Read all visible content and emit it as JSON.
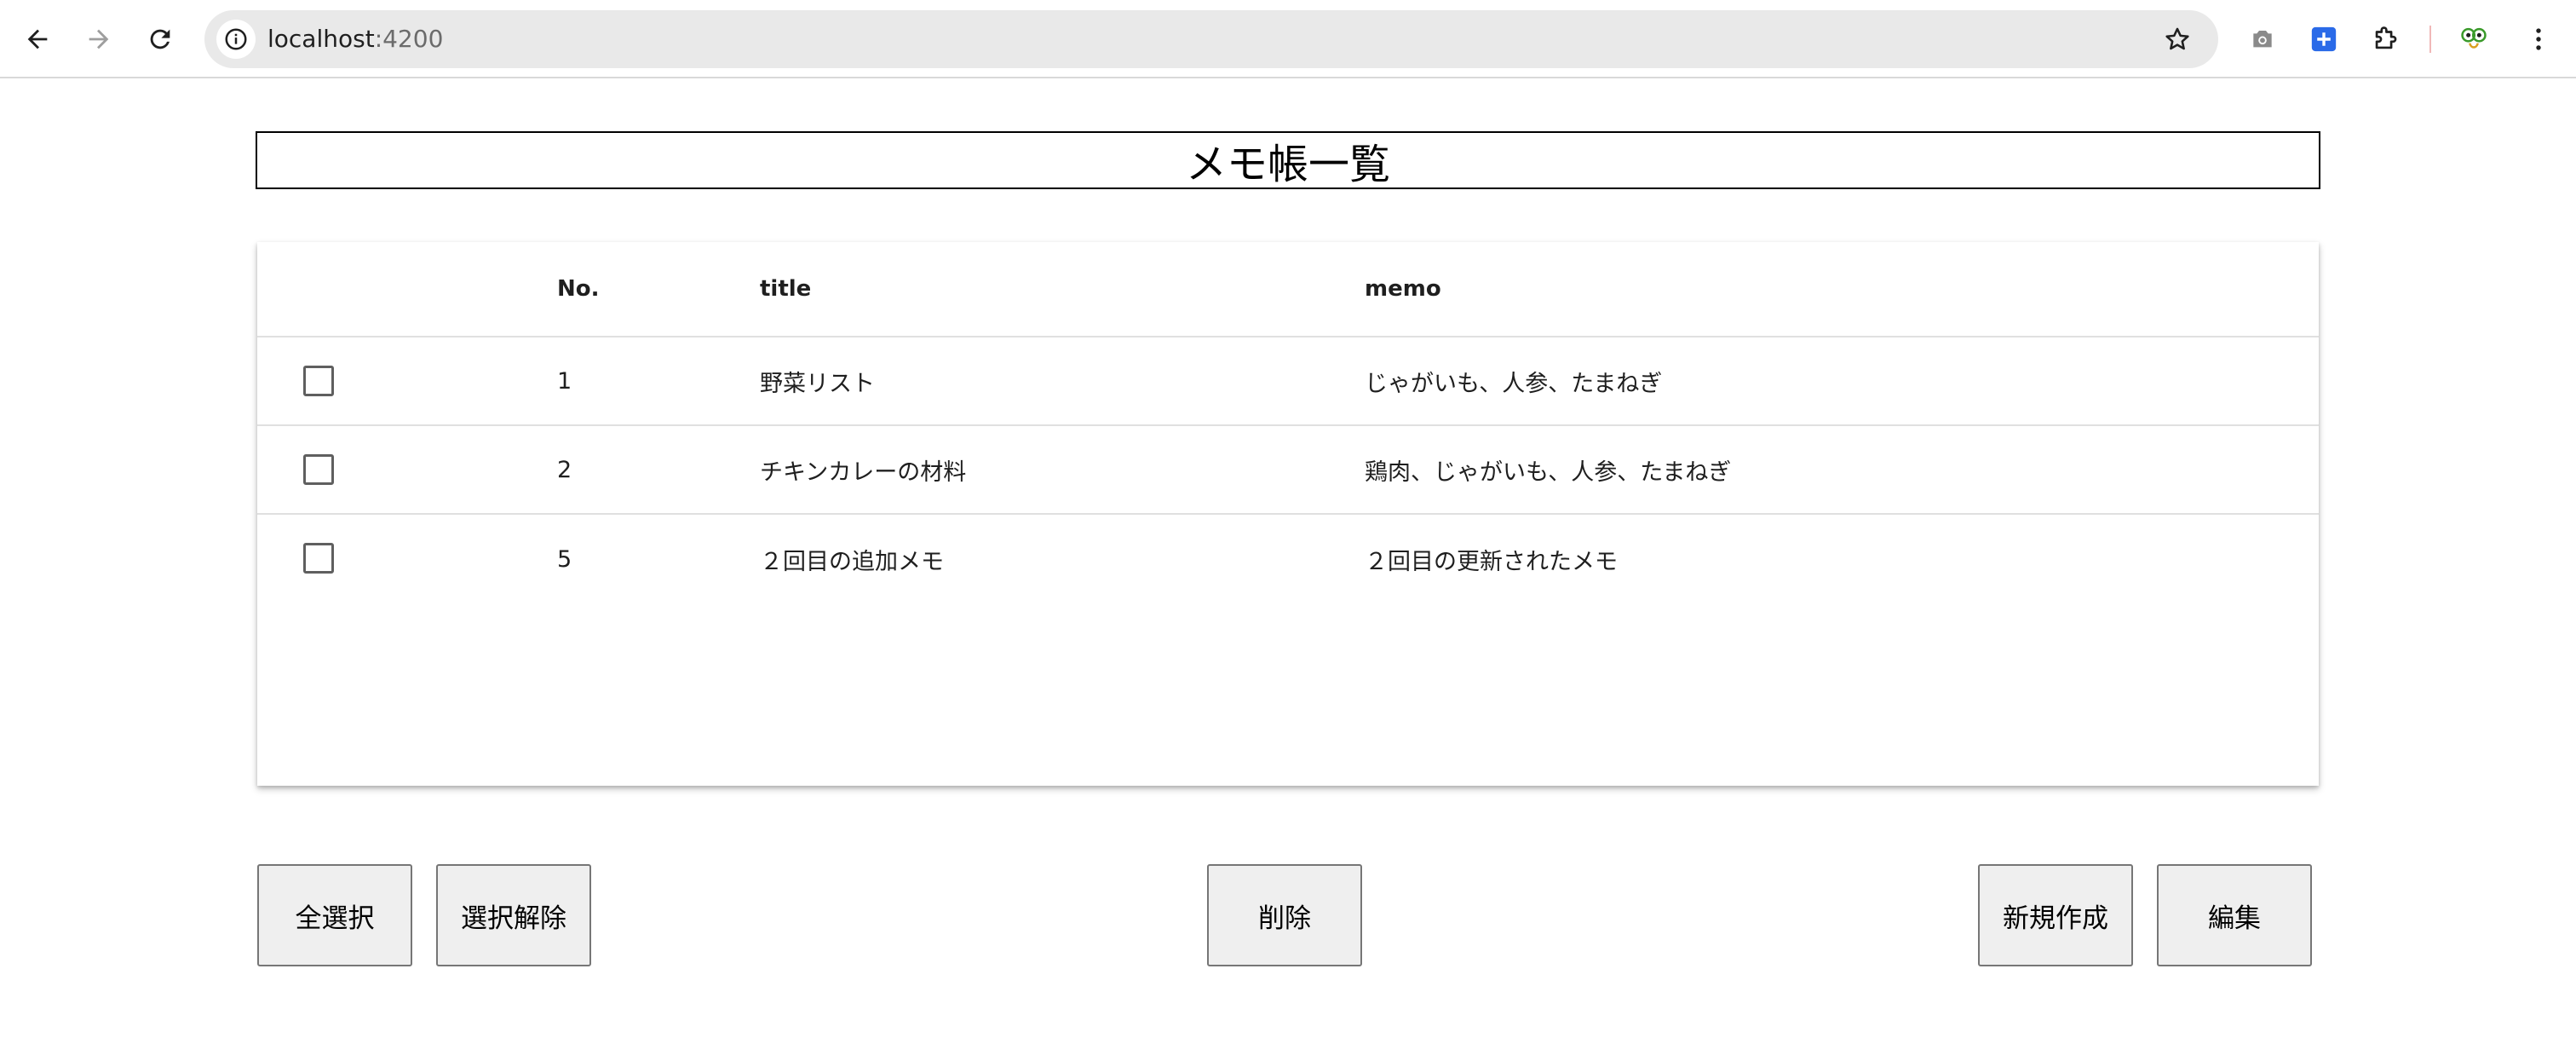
{
  "browser": {
    "url_host": "localhost",
    "url_port": ":4200"
  },
  "page": {
    "title": "メモ帳一覧"
  },
  "table": {
    "headers": {
      "no": "No.",
      "title": "title",
      "memo": "memo"
    },
    "rows": [
      {
        "no": "1",
        "title": "野菜リスト",
        "memo": "じゃがいも、人参、たまねぎ",
        "checked": false
      },
      {
        "no": "2",
        "title": "チキンカレーの材料",
        "memo": "鶏肉、じゃがいも、人参、たまねぎ",
        "checked": false
      },
      {
        "no": "5",
        "title": "２回目の追加メモ",
        "memo": "２回目の更新されたメモ",
        "checked": false
      }
    ]
  },
  "buttons": {
    "select_all": "全選択",
    "deselect": "選択解除",
    "delete": "削除",
    "create": "新規作成",
    "edit": "編集"
  }
}
